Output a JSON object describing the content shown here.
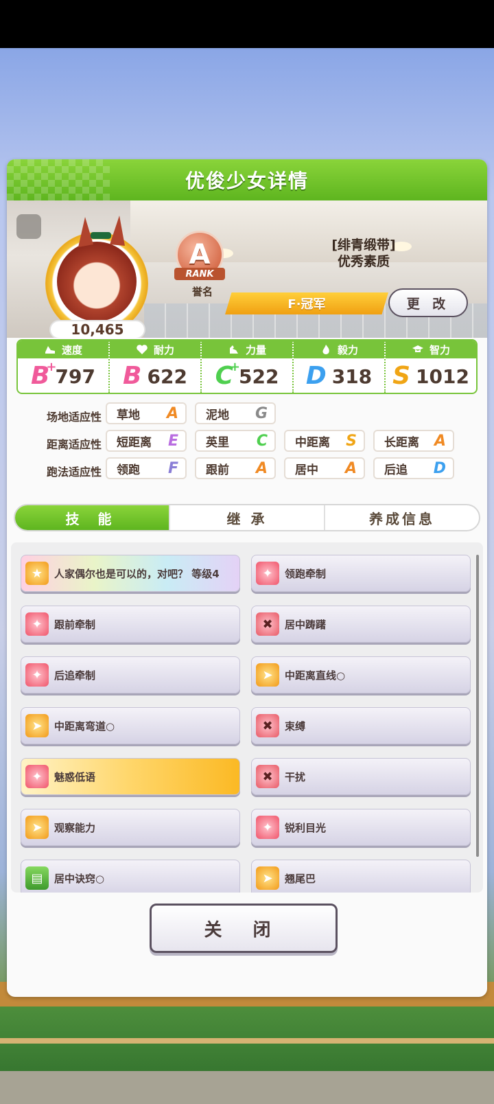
{
  "dialog": {
    "title": "优俊少女详情",
    "score": "10,465",
    "rank": {
      "letter": "A",
      "ribbon": "RANK",
      "label": "誉名"
    },
    "title_bracket": "[绯青缎带]",
    "title_name": "优秀素质",
    "epithet": "F·冠军",
    "change_label": "更 改"
  },
  "stats": [
    {
      "label": "速度",
      "icon": "shoe-icon",
      "grade": "B",
      "plus": "+",
      "value": "797"
    },
    {
      "label": "耐力",
      "icon": "heart-icon",
      "grade": "B",
      "plus": "",
      "value": "622"
    },
    {
      "label": "力量",
      "icon": "muscle-icon",
      "grade": "C",
      "plus": "+",
      "value": "522"
    },
    {
      "label": "毅力",
      "icon": "flame-icon",
      "grade": "D",
      "plus": "",
      "value": "318"
    },
    {
      "label": "智力",
      "icon": "graduation-cap-icon",
      "grade": "S",
      "plus": "",
      "value": "1012"
    }
  ],
  "aptitudes": {
    "track": {
      "label": "场地适应性",
      "items": [
        {
          "name": "草地",
          "grade": "A"
        },
        {
          "name": "泥地",
          "grade": "G"
        }
      ]
    },
    "distance": {
      "label": "距离适应性",
      "items": [
        {
          "name": "短距离",
          "grade": "E"
        },
        {
          "name": "英里",
          "grade": "C"
        },
        {
          "name": "中距离",
          "grade": "S"
        },
        {
          "name": "长距离",
          "grade": "A"
        }
      ]
    },
    "strategy": {
      "label": "跑法适应性",
      "items": [
        {
          "name": "领跑",
          "grade": "F"
        },
        {
          "name": "跟前",
          "grade": "A"
        },
        {
          "name": "居中",
          "grade": "A"
        },
        {
          "name": "后追",
          "grade": "D"
        }
      ]
    }
  },
  "tabs": [
    "技 能",
    "继 承",
    "养成信息"
  ],
  "skills": [
    {
      "name": "人家偶尔也是可以的，对吧？ 等级4",
      "icon": "unique-skill-icon"
    },
    {
      "name": "领跑牵制",
      "icon": "debuff-icon"
    },
    {
      "name": "跟前牵制",
      "icon": "debuff-icon"
    },
    {
      "name": "居中踌躇",
      "icon": "debuff-icon"
    },
    {
      "name": "后追牵制",
      "icon": "debuff-icon"
    },
    {
      "name": "中距离直线○",
      "icon": "speed-icon"
    },
    {
      "name": "中距离弯道○",
      "icon": "speed-icon"
    },
    {
      "name": "束缚",
      "icon": "debuff-icon"
    },
    {
      "name": "魅惑低语",
      "icon": "debuff-icon"
    },
    {
      "name": "干扰",
      "icon": "debuff-icon"
    },
    {
      "name": "观察能力",
      "icon": "speed-icon"
    },
    {
      "name": "锐利目光",
      "icon": "debuff-icon"
    },
    {
      "name": "居中诀窍○",
      "icon": "book-icon"
    },
    {
      "name": "翘尾巴",
      "icon": "speed-icon"
    }
  ],
  "close_label": "关 闭"
}
